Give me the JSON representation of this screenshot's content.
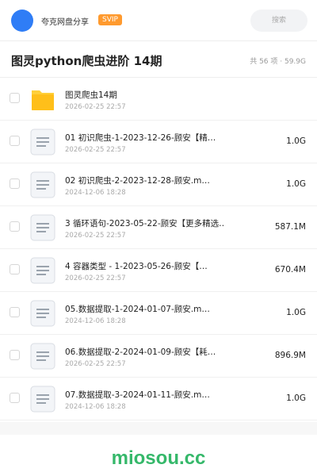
{
  "header": {
    "app_name": "夸克网盘分享",
    "badge": "SVIP",
    "search_placeholder": "搜索"
  },
  "folder": {
    "title": "图灵python爬虫进阶 14期",
    "summary": "共 56 项 · 59.9G"
  },
  "colors": {
    "accent_blue": "#2f7df6",
    "svip_orange": "#ff9a2e",
    "watermark_green": "#35b86a"
  },
  "items": [
    {
      "type": "folder-icon",
      "name": "图灵爬虫14期",
      "date": "2026-02-25 22:57",
      "size": ""
    },
    {
      "type": "file-icon",
      "name": "01 初识爬虫-1-2023-12-26-顾安【精…",
      "date": "2026-02-25 22:57",
      "size": "1.0G"
    },
    {
      "type": "file-icon",
      "name": "02 初识爬虫-2-2023-12-28-顾安.m…",
      "date": "2024-12-06 18:28",
      "size": "1.0G"
    },
    {
      "type": "file-icon",
      "name": "3 循环语句-2023-05-22-顾安【更多精选…",
      "date": "2026-02-25 22:57",
      "size": "587.1M"
    },
    {
      "type": "file-icon",
      "name": "4 容器类型 - 1-2023-05-26-顾安【…",
      "date": "2026-02-25 22:57",
      "size": "670.4M"
    },
    {
      "type": "file-icon",
      "name": "05.数据提取-1-2024-01-07-顾安.m…",
      "date": "2024-12-06 18:28",
      "size": "1.0G"
    },
    {
      "type": "file-icon",
      "name": "06.数据提取-2-2024-01-09-顾安【耗…",
      "date": "2026-02-25 22:57",
      "size": "896.9M"
    },
    {
      "type": "file-icon",
      "name": "07.数据提取-3-2024-01-11-顾安.m…",
      "date": "2024-12-06 18:28",
      "size": "1.0G"
    }
  ],
  "watermark": "miosou.cc"
}
